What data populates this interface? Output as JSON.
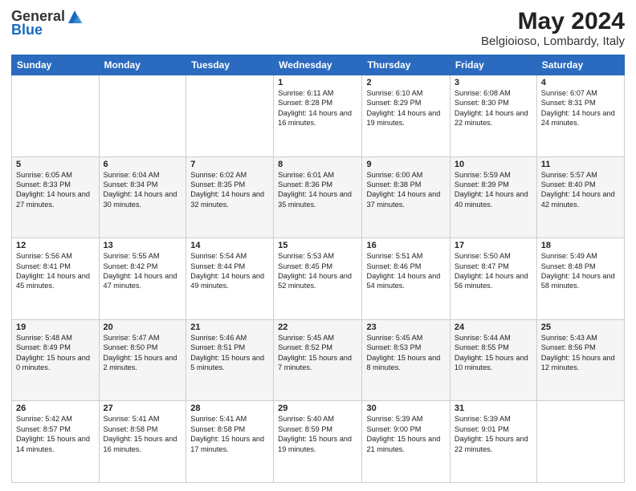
{
  "header": {
    "logo_general": "General",
    "logo_blue": "Blue",
    "month_title": "May 2024",
    "location": "Belgioioso, Lombardy, Italy"
  },
  "weekdays": [
    "Sunday",
    "Monday",
    "Tuesday",
    "Wednesday",
    "Thursday",
    "Friday",
    "Saturday"
  ],
  "weeks": [
    [
      {
        "day": "",
        "info": ""
      },
      {
        "day": "",
        "info": ""
      },
      {
        "day": "",
        "info": ""
      },
      {
        "day": "1",
        "info": "Sunrise: 6:11 AM\nSunset: 8:28 PM\nDaylight: 14 hours and 16 minutes."
      },
      {
        "day": "2",
        "info": "Sunrise: 6:10 AM\nSunset: 8:29 PM\nDaylight: 14 hours and 19 minutes."
      },
      {
        "day": "3",
        "info": "Sunrise: 6:08 AM\nSunset: 8:30 PM\nDaylight: 14 hours and 22 minutes."
      },
      {
        "day": "4",
        "info": "Sunrise: 6:07 AM\nSunset: 8:31 PM\nDaylight: 14 hours and 24 minutes."
      }
    ],
    [
      {
        "day": "5",
        "info": "Sunrise: 6:05 AM\nSunset: 8:33 PM\nDaylight: 14 hours and 27 minutes."
      },
      {
        "day": "6",
        "info": "Sunrise: 6:04 AM\nSunset: 8:34 PM\nDaylight: 14 hours and 30 minutes."
      },
      {
        "day": "7",
        "info": "Sunrise: 6:02 AM\nSunset: 8:35 PM\nDaylight: 14 hours and 32 minutes."
      },
      {
        "day": "8",
        "info": "Sunrise: 6:01 AM\nSunset: 8:36 PM\nDaylight: 14 hours and 35 minutes."
      },
      {
        "day": "9",
        "info": "Sunrise: 6:00 AM\nSunset: 8:38 PM\nDaylight: 14 hours and 37 minutes."
      },
      {
        "day": "10",
        "info": "Sunrise: 5:59 AM\nSunset: 8:39 PM\nDaylight: 14 hours and 40 minutes."
      },
      {
        "day": "11",
        "info": "Sunrise: 5:57 AM\nSunset: 8:40 PM\nDaylight: 14 hours and 42 minutes."
      }
    ],
    [
      {
        "day": "12",
        "info": "Sunrise: 5:56 AM\nSunset: 8:41 PM\nDaylight: 14 hours and 45 minutes."
      },
      {
        "day": "13",
        "info": "Sunrise: 5:55 AM\nSunset: 8:42 PM\nDaylight: 14 hours and 47 minutes."
      },
      {
        "day": "14",
        "info": "Sunrise: 5:54 AM\nSunset: 8:44 PM\nDaylight: 14 hours and 49 minutes."
      },
      {
        "day": "15",
        "info": "Sunrise: 5:53 AM\nSunset: 8:45 PM\nDaylight: 14 hours and 52 minutes."
      },
      {
        "day": "16",
        "info": "Sunrise: 5:51 AM\nSunset: 8:46 PM\nDaylight: 14 hours and 54 minutes."
      },
      {
        "day": "17",
        "info": "Sunrise: 5:50 AM\nSunset: 8:47 PM\nDaylight: 14 hours and 56 minutes."
      },
      {
        "day": "18",
        "info": "Sunrise: 5:49 AM\nSunset: 8:48 PM\nDaylight: 14 hours and 58 minutes."
      }
    ],
    [
      {
        "day": "19",
        "info": "Sunrise: 5:48 AM\nSunset: 8:49 PM\nDaylight: 15 hours and 0 minutes."
      },
      {
        "day": "20",
        "info": "Sunrise: 5:47 AM\nSunset: 8:50 PM\nDaylight: 15 hours and 2 minutes."
      },
      {
        "day": "21",
        "info": "Sunrise: 5:46 AM\nSunset: 8:51 PM\nDaylight: 15 hours and 5 minutes."
      },
      {
        "day": "22",
        "info": "Sunrise: 5:45 AM\nSunset: 8:52 PM\nDaylight: 15 hours and 7 minutes."
      },
      {
        "day": "23",
        "info": "Sunrise: 5:45 AM\nSunset: 8:53 PM\nDaylight: 15 hours and 8 minutes."
      },
      {
        "day": "24",
        "info": "Sunrise: 5:44 AM\nSunset: 8:55 PM\nDaylight: 15 hours and 10 minutes."
      },
      {
        "day": "25",
        "info": "Sunrise: 5:43 AM\nSunset: 8:56 PM\nDaylight: 15 hours and 12 minutes."
      }
    ],
    [
      {
        "day": "26",
        "info": "Sunrise: 5:42 AM\nSunset: 8:57 PM\nDaylight: 15 hours and 14 minutes."
      },
      {
        "day": "27",
        "info": "Sunrise: 5:41 AM\nSunset: 8:58 PM\nDaylight: 15 hours and 16 minutes."
      },
      {
        "day": "28",
        "info": "Sunrise: 5:41 AM\nSunset: 8:58 PM\nDaylight: 15 hours and 17 minutes."
      },
      {
        "day": "29",
        "info": "Sunrise: 5:40 AM\nSunset: 8:59 PM\nDaylight: 15 hours and 19 minutes."
      },
      {
        "day": "30",
        "info": "Sunrise: 5:39 AM\nSunset: 9:00 PM\nDaylight: 15 hours and 21 minutes."
      },
      {
        "day": "31",
        "info": "Sunrise: 5:39 AM\nSunset: 9:01 PM\nDaylight: 15 hours and 22 minutes."
      },
      {
        "day": "",
        "info": ""
      }
    ]
  ]
}
